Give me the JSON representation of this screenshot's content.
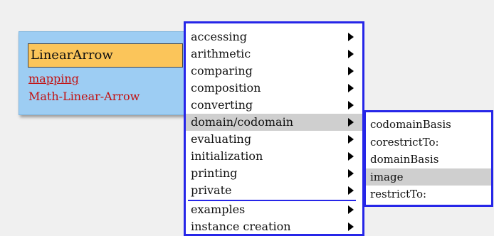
{
  "browser": {
    "class_name": "LinearArrow",
    "category": "mapping",
    "package": "Math-Linear-Arrow"
  },
  "main_menu": {
    "items": [
      {
        "label": "accessing",
        "has_submenu": true
      },
      {
        "label": "arithmetic",
        "has_submenu": true
      },
      {
        "label": "comparing",
        "has_submenu": true
      },
      {
        "label": "composition",
        "has_submenu": true
      },
      {
        "label": "converting",
        "has_submenu": true
      },
      {
        "label": "domain/codomain",
        "has_submenu": true,
        "selected": true
      },
      {
        "label": "evaluating",
        "has_submenu": true
      },
      {
        "label": "initialization",
        "has_submenu": true
      },
      {
        "label": "printing",
        "has_submenu": true
      },
      {
        "label": "private",
        "has_submenu": true
      },
      {
        "label": "examples",
        "has_submenu": true
      },
      {
        "label": "instance creation",
        "has_submenu": true
      }
    ]
  },
  "sub_menu": {
    "items": [
      {
        "label": "codomainBasis"
      },
      {
        "label": "corestrictTo:"
      },
      {
        "label": "domainBasis"
      },
      {
        "label": "image",
        "selected": true
      },
      {
        "label": "restrictTo:"
      }
    ]
  },
  "colors": {
    "menu_border": "#2626e8",
    "panel_bg": "#9dcdf3",
    "class_field_bg": "#fbc55a",
    "link_red": "#c21212",
    "selection_gray": "#cfcfcf"
  }
}
